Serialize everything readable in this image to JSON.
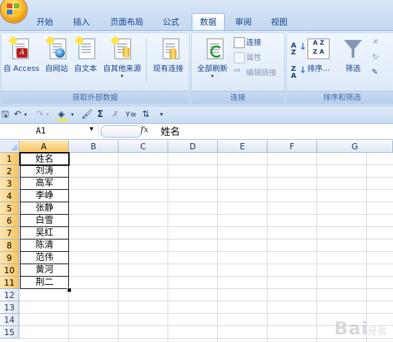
{
  "tabs": [
    "开始",
    "插入",
    "页面布局",
    "公式",
    "数据",
    "审阅",
    "视图"
  ],
  "active_tab": "数据",
  "ribbon": {
    "external_group": {
      "label": "获取外部数据",
      "buttons": [
        "自 Access",
        "自网站",
        "自文本",
        "自其他来源",
        "现有连接"
      ]
    },
    "connections_group": {
      "label": "连接",
      "refresh_label": "全部刷新",
      "connections_label": "连接",
      "properties_label": "属性",
      "edit_links_label": "编辑链接"
    },
    "sort_group": {
      "label": "排序和筛选",
      "sort_label": "排序...",
      "filter_label": "筛选"
    }
  },
  "formula_bar": {
    "name_box": "A1",
    "fx": "fx",
    "value": "姓名"
  },
  "sheet": {
    "columns": [
      "A",
      "B",
      "C",
      "D",
      "E",
      "F",
      "G"
    ],
    "rows": [
      "1",
      "2",
      "3",
      "4",
      "5",
      "6",
      "7",
      "8",
      "9",
      "10",
      "11",
      "12",
      "13",
      "14",
      "15"
    ],
    "column_a": [
      "姓名",
      "刘涛",
      "高军",
      "李峥",
      "张静",
      "白雪",
      "吴红",
      "陈清",
      "范伟",
      "黄河",
      "荆二"
    ]
  },
  "watermark": {
    "text": "Bai",
    "suffix": "经验"
  }
}
